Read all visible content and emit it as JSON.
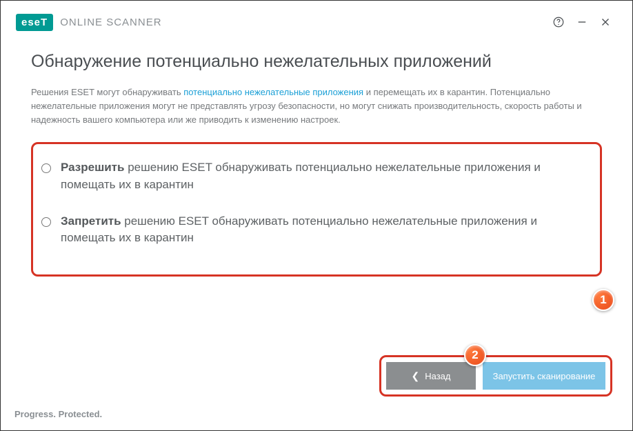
{
  "brand": {
    "logo_text": "eseT",
    "product": "ONLINE SCANNER"
  },
  "title": "Обнаружение потенциально нежелательных приложений",
  "intro": {
    "pre": "Решения ESET могут обнаруживать ",
    "link": "потенциально нежелательные приложения",
    "post": " и перемещать их в карантин. Потенциально нежелательные приложения могут не представлять угрозу безопасности, но могут снижать производительность, скорость работы и надежность вашего компьютера или же приводить к изменению настроек."
  },
  "options": [
    {
      "bold": "Разрешить",
      "rest": " решению ESET обнаруживать потенциально нежелательные приложения и помещать их в карантин"
    },
    {
      "bold": "Запретить",
      "rest": " решению ESET обнаруживать потенциально нежелательные приложения и помещать их в карантин"
    }
  ],
  "buttons": {
    "back": "Назад",
    "start": "Запустить сканирование"
  },
  "footer": "Progress. Protected.",
  "callouts": {
    "one": "1",
    "two": "2"
  }
}
